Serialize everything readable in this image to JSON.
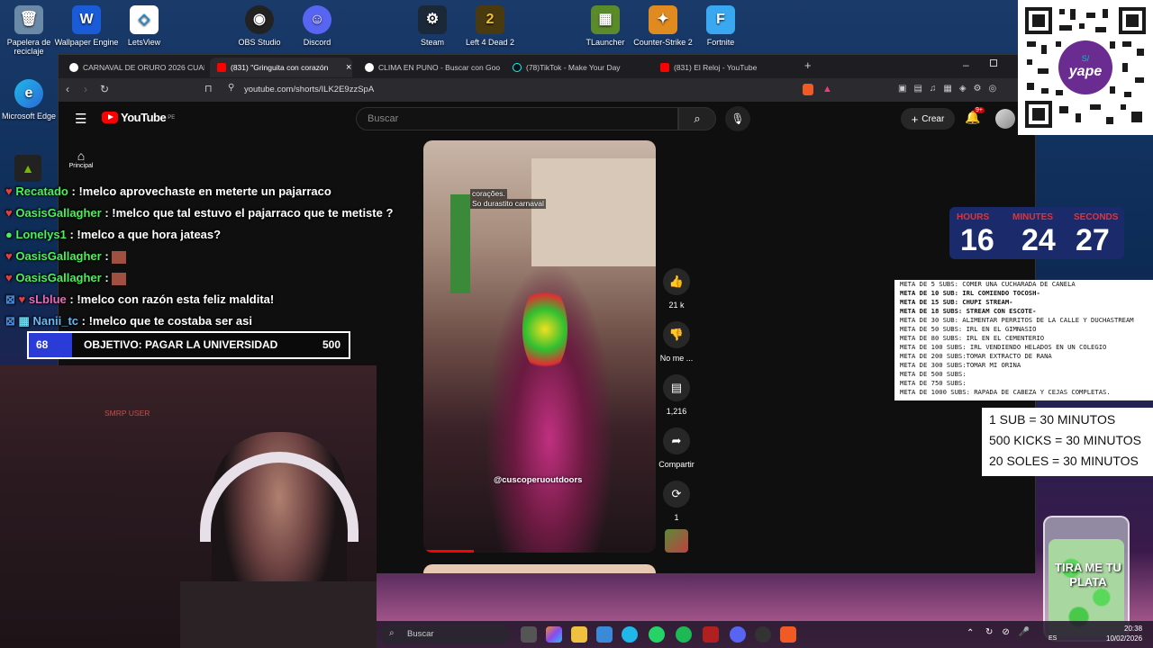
{
  "desktop_icons": [
    {
      "label": "Papelera de reciclaje",
      "icon": "recycle-bin-icon"
    },
    {
      "label": "Wallpaper Engine",
      "icon": "wallpaper-engine-icon"
    },
    {
      "label": "LetsView",
      "icon": "letsview-icon"
    },
    {
      "label": "OBS Studio",
      "icon": "obs-icon"
    },
    {
      "label": "Discord",
      "icon": "discord-icon"
    },
    {
      "label": "Steam",
      "icon": "steam-icon"
    },
    {
      "label": "Left 4 Dead 2",
      "icon": "l4d2-icon"
    },
    {
      "label": "TLauncher",
      "icon": "tlauncher-icon"
    },
    {
      "label": "Counter-Strike 2",
      "icon": "cs2-icon"
    },
    {
      "label": "Fortnite",
      "icon": "fortnite-icon"
    },
    {
      "label": "Microsoft Edge",
      "icon": "edge-icon"
    }
  ],
  "browser": {
    "tabs": [
      {
        "label": "CARNAVAL DE ORURO 2026 CUANDO",
        "active": false,
        "favicon_color": "#ffffff"
      },
      {
        "label": "(831) \"Gringuita con corazón",
        "active": true,
        "favicon_color": "#ff0000"
      },
      {
        "label": "CLIMA EN PUNO - Buscar con Google",
        "active": false,
        "favicon_color": "#ffffff"
      },
      {
        "label": "(78)TikTok - Make Your Day",
        "active": false,
        "favicon_color": "#ffffff"
      },
      {
        "label": "(831) El Reloj - YouTube",
        "active": false,
        "favicon_color": "#ff0000"
      }
    ],
    "close_tab": "×",
    "new_tab": "+",
    "url": "youtube.com/shorts/ILK2E9zzSpA"
  },
  "youtube": {
    "logo_text": "YouTube",
    "region": "PE",
    "search_placeholder": "Buscar",
    "create_label": "Crear",
    "notifications_badge": "9+",
    "home_label": "Principal",
    "video_caption_line1": "corações.",
    "video_caption_line2": "So durastito carnaval",
    "video_watermark": "@cuscoperuoutdoors",
    "likes": "21 k",
    "dislike_label": "No me ...",
    "comments": "1,216",
    "share_label": "Compartir",
    "remix_count": "1"
  },
  "chat": [
    {
      "user": "Recatado",
      "message": ": !melco aprovechaste en meterte un pajarraco"
    },
    {
      "user": "OasisGallagher",
      "message": ": !melco que tal estuvo el pajarraco que te metiste ?"
    },
    {
      "user": "Lonelys1",
      "message": ": !melco a que hora jateas?"
    },
    {
      "user": "OasisGallagher",
      "message": ":"
    },
    {
      "user": "OasisGallagher",
      "message": ":"
    },
    {
      "user": "sLblue",
      "message": ": !melco con razón esta feliz maldita!"
    },
    {
      "user": "Nanii_tc",
      "message": ": !melco que te costaba ser asi"
    }
  ],
  "goal": {
    "current": "68",
    "label": "OBJETIVO: PAGAR LA UNIVERSIDAD",
    "target": "500",
    "progress": 0.136
  },
  "webcam_sign": "SMRP USER",
  "timer": {
    "hours_label": "HOURS",
    "minutes_label": "MINUTES",
    "seconds_label": "SECONDS",
    "hours": "16",
    "minutes": "24",
    "seconds": "27"
  },
  "goals_list": [
    {
      "text": "META DE 5 SUBS: COMER UNA CUCHARADA DE CANELA",
      "bold": false
    },
    {
      "text": "META DE 10 SUB: IRL COMIENDO TOCOSH-",
      "bold": true
    },
    {
      "text": "META DE 15 SUB: CHUPI STREAM-",
      "bold": true
    },
    {
      "text": "META DE 18 SUBS: STREAM CON ESCOTE-",
      "bold": true
    },
    {
      "text": "META DE 30 SUB:  ALIMENTAR PERRITOS DE LA CALLE Y DUCHASTREAM",
      "bold": false
    },
    {
      "text": "META DE 50 SUBS: IRL EN EL GIMNASIO",
      "bold": false
    },
    {
      "text": "META DE 80 SUBS: IRL EN EL CEMENTERIO",
      "bold": false
    },
    {
      "text": "META DE 100 SUBS: IRL VENDIENDO HELADOS EN UN COLEGIO",
      "bold": false
    },
    {
      "text": "META DE 200 SUBS:TOMAR EXTRACTO DE RANA",
      "bold": false
    },
    {
      "text": "META DE 300 SUBS:TOMAR MI ORINA",
      "bold": false
    },
    {
      "text": "META DE 500 SUBS:",
      "bold": false
    },
    {
      "text": "META DE 750 SUBS:",
      "bold": false
    },
    {
      "text": "META DE 1000 SUBS: RAPADA DE CABEZA Y CEJAS COMPLETAS.",
      "bold": false
    }
  ],
  "rates": [
    "1 SUB = 30 MINUTOS",
    "500 KICKS = 30 MINUTOS",
    "20 SOLES = 30 MINUTOS"
  ],
  "qr_brand": "yape",
  "jar_text": "TIRA ME TU PLATA",
  "taskbar": {
    "search_placeholder": "Buscar",
    "time": "20:38",
    "date": "10/02/2026",
    "lang": "ES"
  },
  "colors": {
    "accent_red": "#ff0000",
    "chat_user": "#4ef05a",
    "goal_fill": "#2a3bd8",
    "timer_bg": "#1b2a6a",
    "yape_purple": "#6b2c91"
  }
}
